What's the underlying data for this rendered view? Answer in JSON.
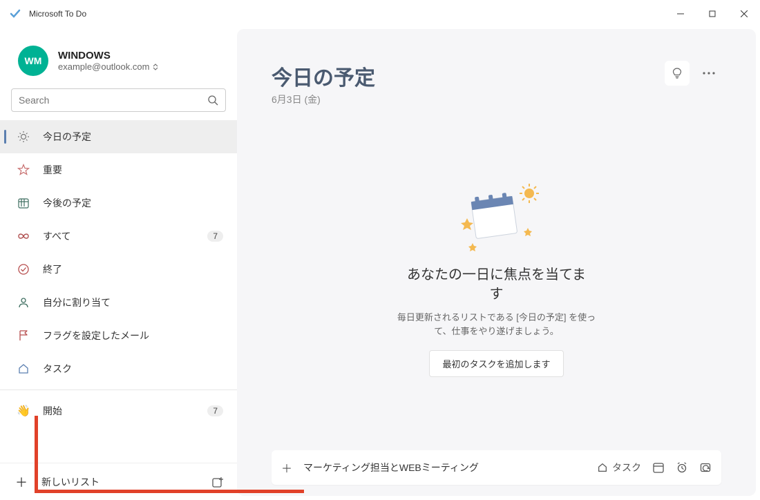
{
  "window": {
    "title": "Microsoft To Do"
  },
  "account": {
    "initials": "WM",
    "name": "WINDOWS",
    "email": "example@outlook.com"
  },
  "search": {
    "placeholder": "Search"
  },
  "sidebar": {
    "items": [
      {
        "label": "今日の予定",
        "icon": "sun",
        "active": true
      },
      {
        "label": "重要",
        "icon": "star"
      },
      {
        "label": "今後の予定",
        "icon": "calendar"
      },
      {
        "label": "すべて",
        "icon": "infinity",
        "badge": "7"
      },
      {
        "label": "終了",
        "icon": "check-circle"
      },
      {
        "label": "自分に割り当て",
        "icon": "person"
      },
      {
        "label": "フラグを設定したメール",
        "icon": "flag"
      },
      {
        "label": "タスク",
        "icon": "home"
      }
    ],
    "extra": [
      {
        "label": "開始",
        "icon": "wave",
        "badge": "7"
      }
    ],
    "newList": "新しいリスト"
  },
  "main": {
    "title": "今日の予定",
    "date": "6月3日 (金)",
    "empty": {
      "heading": "あなたの一日に焦点を当てます",
      "desc": "毎日更新されるリストである [今日の予定] を使って、仕事をやり遂げましょう。",
      "button": "最初のタスクを追加します"
    },
    "addTask": {
      "text": "マーケティング担当とWEBミーティング",
      "listLabel": "タスク"
    }
  }
}
